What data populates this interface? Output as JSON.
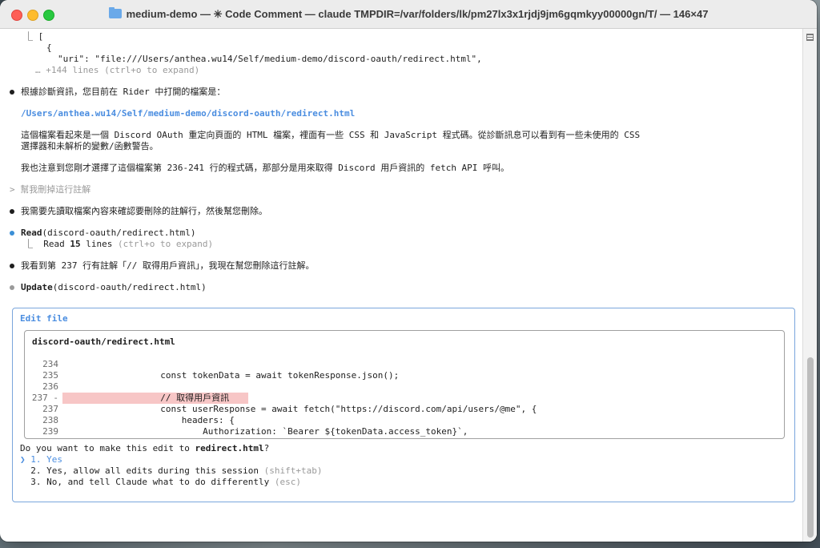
{
  "window": {
    "title": "medium-demo — ✳ Code Comment — claude TMPDIR=/var/folders/lk/pm27lx3x1rjdj9jm6gqmkyy00000gn/T/ — 146×47"
  },
  "terminal": {
    "top_tree": "⎿ [",
    "brace": "{",
    "uri_line": "\"uri\": \"file:///Users/anthea.wu14/Self/medium-demo/discord-oauth/redirect.html\",",
    "more_lines": "… +144 lines (ctrl+o to expand)",
    "msg1": "根據診斷資訊，您目前在 Rider 中打開的檔案是：",
    "path_link": "/Users/anthea.wu14/Self/medium-demo/discord-oauth/redirect.html",
    "msg2a": "這個檔案看起來是一個 Discord OAuth 重定向頁面的 HTML 檔案，裡面有一些 CSS 和 JavaScript 程式碼。從診斷訊息可以看到有一些未使用的 CSS",
    "msg2b": "選擇器和未解析的變數/函數警告。",
    "msg3": "我也注意到您剛才選擇了這個檔案第 236-241 行的程式碼，那部分是用來取得 Discord 用戶資訊的 fetch API 呼叫。",
    "user_prompt": "> 幫我刪掉這行註解",
    "msg4": "我需要先讀取檔案內容來確認要刪除的註解行，然後幫您刪除。",
    "read_tool": "Read",
    "read_arg": "(discord-oauth/redirect.html)",
    "read_result_prefix": "⎿  Read ",
    "read_count": "15",
    "read_result_suffix": " lines ",
    "read_hint": "(ctrl+o to expand)",
    "msg5": "我看到第 237 行有註解「// 取得用戶資訊」，我現在幫您刪除這行註解。",
    "update_tool": "Update",
    "update_arg": "(discord-oauth/redirect.html)"
  },
  "edit": {
    "title": "Edit file",
    "file_name": "discord-oauth/redirect.html",
    "rows": [
      {
        "ln": "234",
        "code": ""
      },
      {
        "ln": "235",
        "code": "                  const tokenData = await tokenResponse.json();"
      },
      {
        "ln": "236",
        "code": ""
      },
      {
        "ln": "237 -",
        "code": "                  // 取得用戶資訊"
      },
      {
        "ln": "237",
        "code": "                  const userResponse = await fetch(\"https://discord.com/api/users/@me\", {"
      },
      {
        "ln": "238",
        "code": "                      headers: {"
      },
      {
        "ln": "239",
        "code": "                          Authorization: `Bearer ${tokenData.access_token}`,"
      }
    ],
    "question_prefix": "Do you want to make this edit to ",
    "question_file": "redirect.html",
    "question_suffix": "?",
    "options": [
      {
        "label": "❯ 1. Yes",
        "hint": ""
      },
      {
        "label": "  2. Yes, allow all edits during this session ",
        "hint": "(shift+tab)"
      },
      {
        "label": "  3. No, and tell Claude what to do differently ",
        "hint": "(esc)"
      }
    ]
  }
}
